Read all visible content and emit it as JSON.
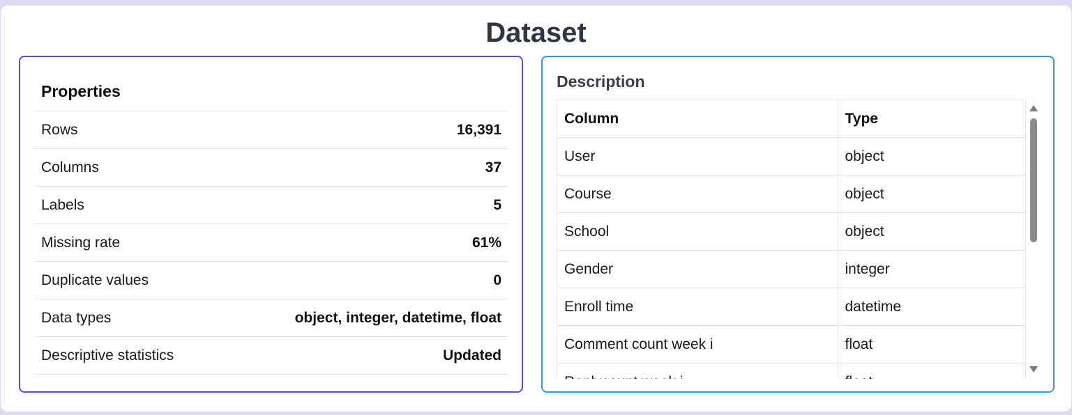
{
  "page": {
    "title": "Dataset"
  },
  "properties": {
    "title": "Properties",
    "rows": [
      {
        "label": "Rows",
        "value": "16,391"
      },
      {
        "label": "Columns",
        "value": "37"
      },
      {
        "label": "Labels",
        "value": "5"
      },
      {
        "label": "Missing rate",
        "value": "61%"
      },
      {
        "label": "Duplicate values",
        "value": "0"
      },
      {
        "label": "Data types",
        "value": "object, integer, datetime, float"
      },
      {
        "label": "Descriptive statistics",
        "value": "Updated"
      }
    ]
  },
  "description": {
    "title": "Description",
    "headers": {
      "column": "Column",
      "type": "Type"
    },
    "rows": [
      {
        "column": "User",
        "type": "object"
      },
      {
        "column": "Course",
        "type": "object"
      },
      {
        "column": "School",
        "type": "object"
      },
      {
        "column": "Gender",
        "type": "integer"
      },
      {
        "column": "Enroll time",
        "type": "datetime"
      },
      {
        "column": "Comment count week i",
        "type": "float"
      },
      {
        "column": "Replycount week i",
        "type": "float"
      }
    ]
  },
  "colors": {
    "left_panel_border": "#5a4fc8",
    "right_panel_border": "#3b95db",
    "page_background": "#e2d9f1"
  }
}
